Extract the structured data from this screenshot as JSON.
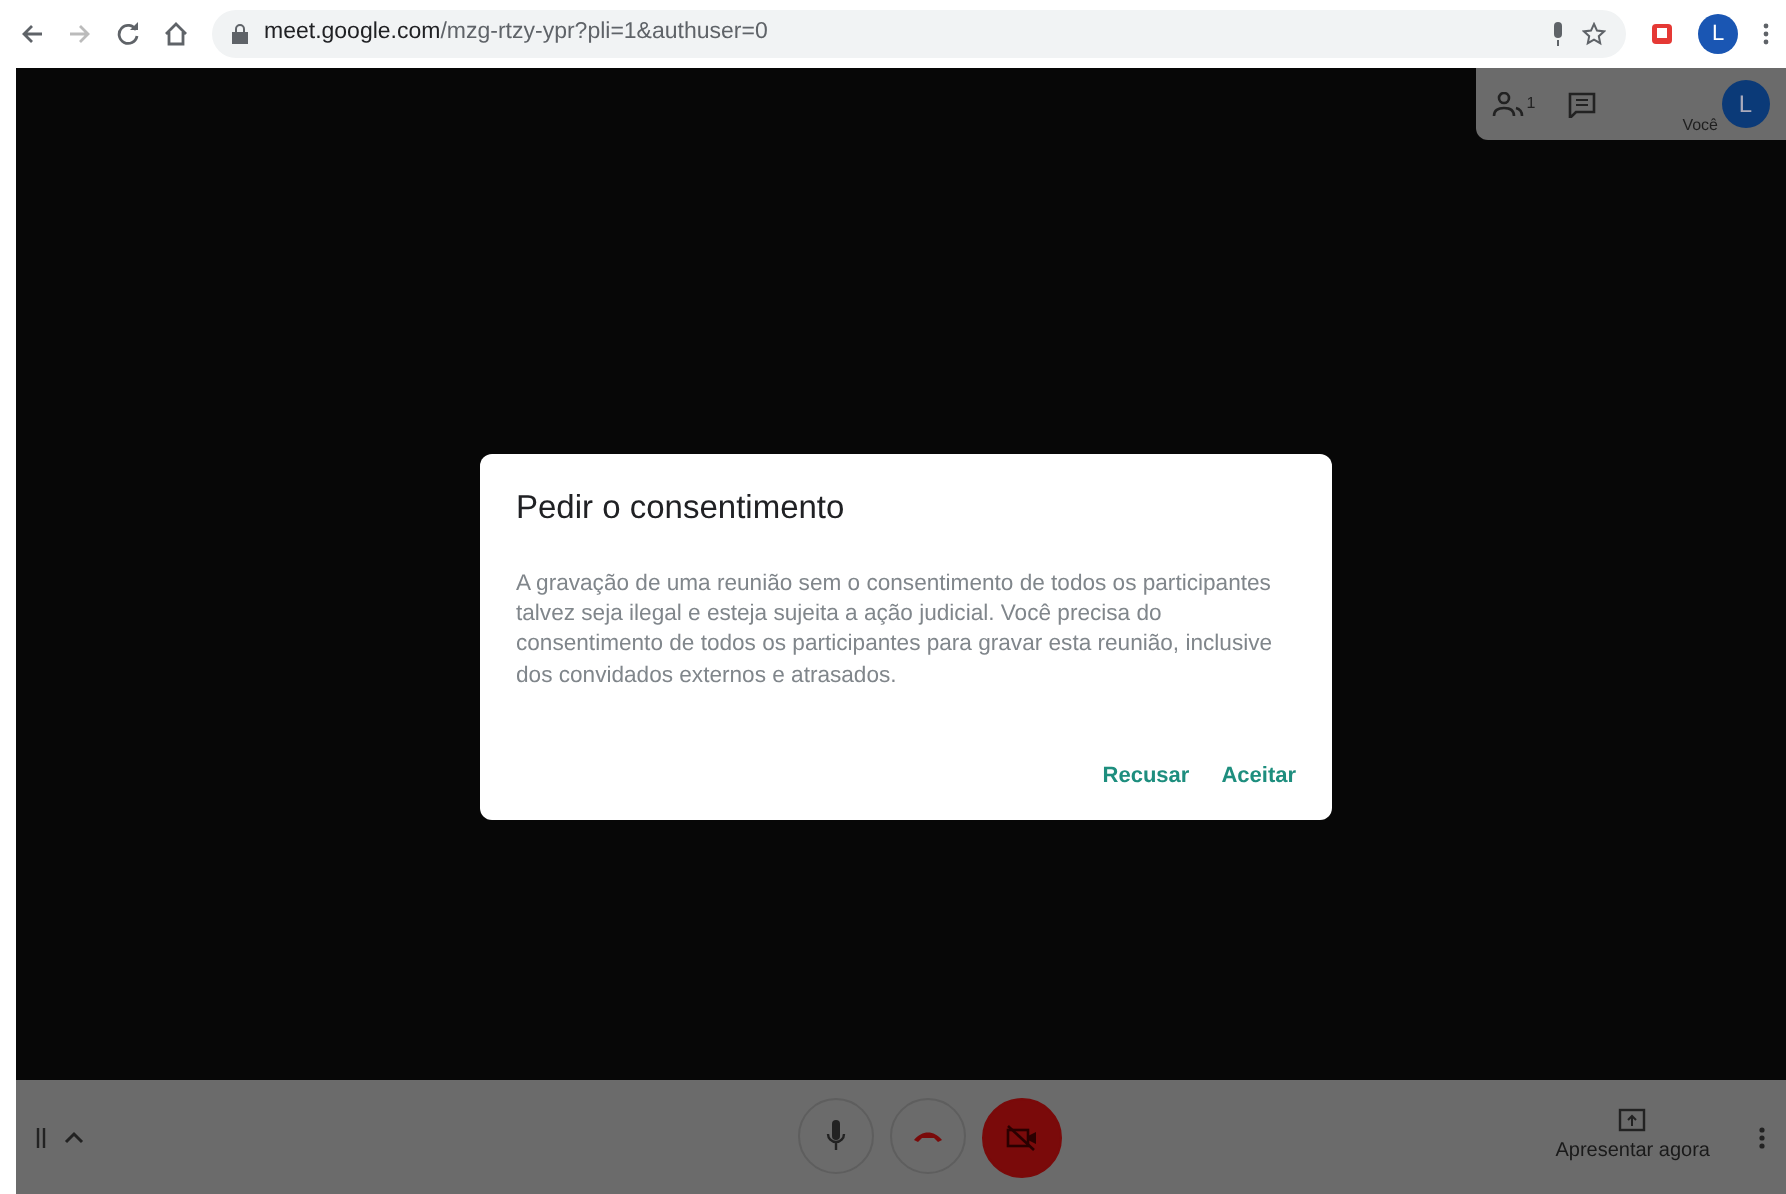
{
  "browser": {
    "url_host": "meet.google.com",
    "url_path": "/mzg-rtzy-ypr?pli=1&authuser=0",
    "profile_letter": "L"
  },
  "top_panel": {
    "participant_count": "1",
    "self_label": "Você",
    "avatar_letter": "L"
  },
  "dialog": {
    "title": "Pedir o consentimento",
    "body": "A gravação de uma reunião sem o consentimento de todos os participantes talvez seja ilegal e esteja sujeita a ação judicial. Você precisa do consentimento de todos os participantes para gravar esta reunião, inclusive dos convidados externos e atrasados.",
    "buttons": [
      {
        "label": "Recusar"
      },
      {
        "label": "Aceitar"
      }
    ]
  },
  "bottom_bar": {
    "camera_on": false,
    "present_label": "Apresentar agora"
  }
}
